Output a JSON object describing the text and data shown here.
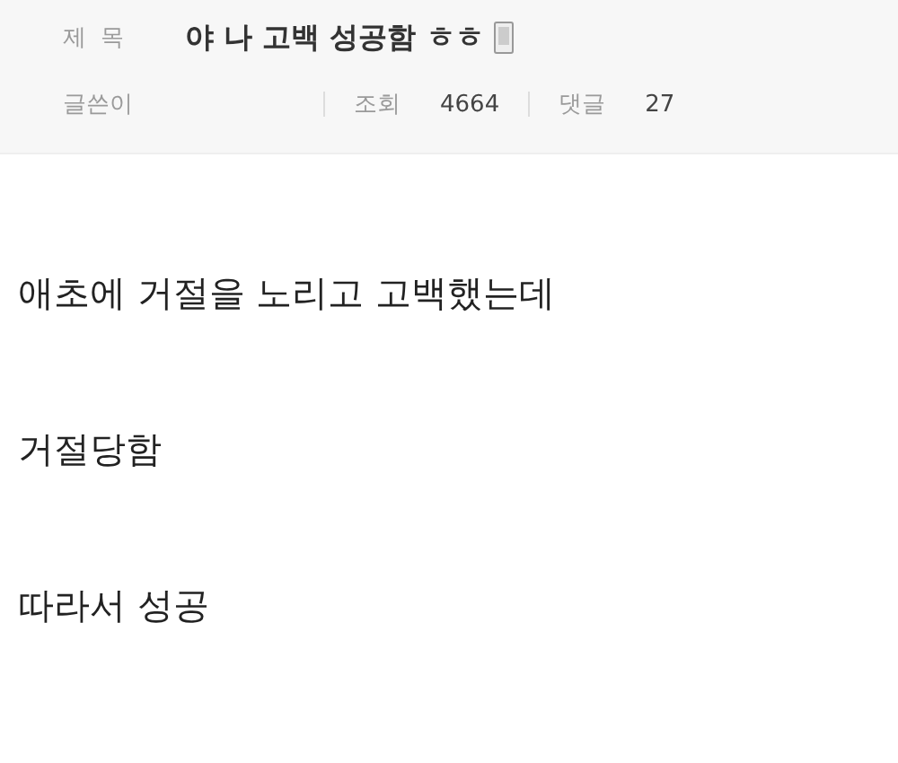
{
  "post": {
    "title_label": "제 목",
    "title": "야 나 고백 성공함 ㅎㅎ",
    "mobile": true,
    "meta": [
      {
        "label": "글쓴이"
      },
      {
        "label": "조회",
        "value": "4664"
      },
      {
        "label": "댓글",
        "value": "27"
      }
    ],
    "body": [
      "애초에 거절을 노리고 고백했는데",
      "거절당함",
      "따라서 성공"
    ]
  }
}
